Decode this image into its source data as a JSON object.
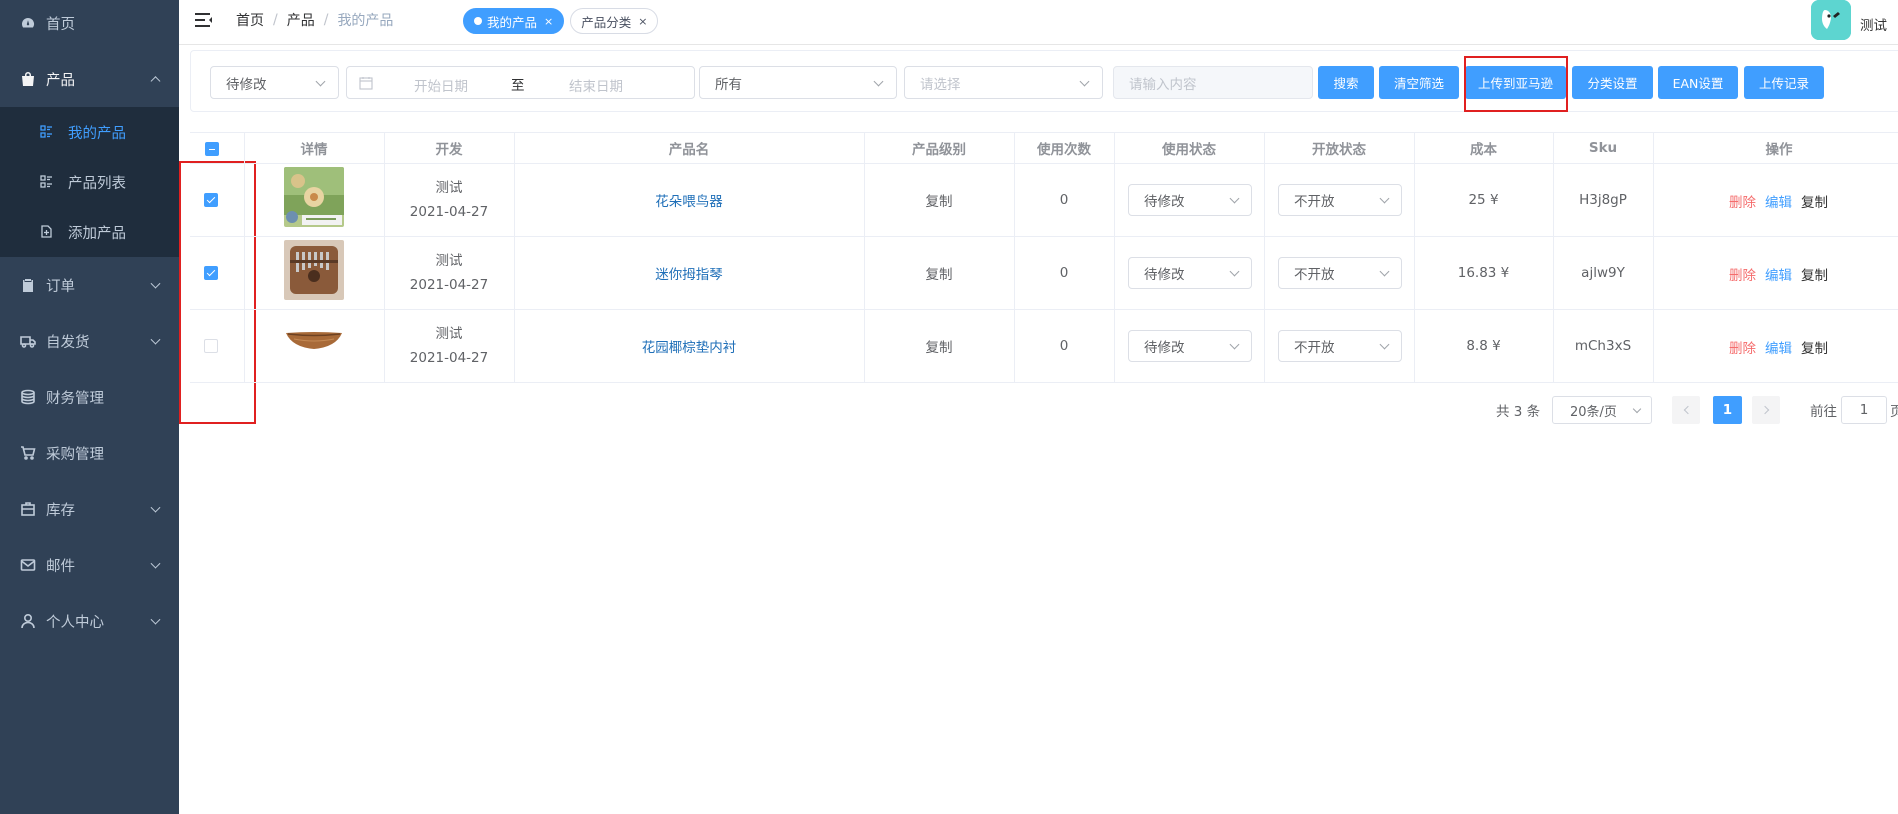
{
  "sidebar": {
    "items": [
      {
        "label": "首页",
        "icon": "dashboard-icon"
      },
      {
        "label": "产品",
        "icon": "shopping-bag-icon"
      },
      {
        "label": "订单",
        "icon": "clipboard-icon"
      },
      {
        "label": "自发货",
        "icon": "truck-icon"
      },
      {
        "label": "财务管理",
        "icon": "database-icon"
      },
      {
        "label": "采购管理",
        "icon": "cart-icon"
      },
      {
        "label": "库存",
        "icon": "inventory-box-icon"
      },
      {
        "label": "邮件",
        "icon": "mail-icon"
      },
      {
        "label": "个人中心",
        "icon": "user-icon"
      }
    ],
    "submenu": [
      {
        "label": "我的产品",
        "icon": "list-icon"
      },
      {
        "label": "产品列表",
        "icon": "list-icon"
      },
      {
        "label": "添加产品",
        "icon": "add-document-icon"
      }
    ]
  },
  "header": {
    "breadcrumb": [
      "首页",
      "产品",
      "我的产品"
    ],
    "tags": [
      "我的产品",
      "产品分类"
    ],
    "user_name": "测试"
  },
  "filters": {
    "status_select": "待修改",
    "date_start_placeholder": "开始日期",
    "date_separator": "至",
    "date_end_placeholder": "结束日期",
    "scope_select": "所有",
    "category_select_placeholder": "请选择",
    "search_placeholder": "请输入内容",
    "buttons": {
      "search": "搜索",
      "clear": "清空筛选",
      "upload_amazon": "上传到亚马逊",
      "category_settings": "分类设置",
      "ean_settings": "EAN设置",
      "upload_records": "上传记录"
    }
  },
  "table": {
    "headers": [
      "详情",
      "开发",
      "产品名",
      "产品级别",
      "使用次数",
      "使用状态",
      "开放状态",
      "成本",
      "Sku",
      "操作"
    ],
    "rows": [
      {
        "developer": "测试",
        "date": "2021-04-27",
        "name": "花朵喂鸟器",
        "level": "复制",
        "uses": "0",
        "use_status": "待修改",
        "open_status": "不开放",
        "cost": "25 ¥",
        "sku": "H3j8gP",
        "checked": true
      },
      {
        "developer": "测试",
        "date": "2021-04-27",
        "name": "迷你拇指琴",
        "level": "复制",
        "uses": "0",
        "use_status": "待修改",
        "open_status": "不开放",
        "cost": "16.83 ¥",
        "sku": "ajlw9Y",
        "checked": true
      },
      {
        "developer": "测试",
        "date": "2021-04-27",
        "name": "花园椰棕垫内衬",
        "level": "复制",
        "uses": "0",
        "use_status": "待修改",
        "open_status": "不开放",
        "cost": "8.8 ¥",
        "sku": "mCh3xS",
        "checked": false
      }
    ],
    "ops": {
      "delete": "删除",
      "edit": "编辑",
      "copy": "复制"
    }
  },
  "pagination": {
    "total": "共 3 条",
    "page_size": "20条/页",
    "current_page": "1",
    "goto_label": "前往",
    "goto_value": "1",
    "page_suffix": "页"
  },
  "colors": {
    "sidebar_bg": "#304156",
    "submenu_bg": "#1f2d3d",
    "primary": "#409eff",
    "danger": "#f56c6c",
    "highlight_box": "#e02020"
  }
}
